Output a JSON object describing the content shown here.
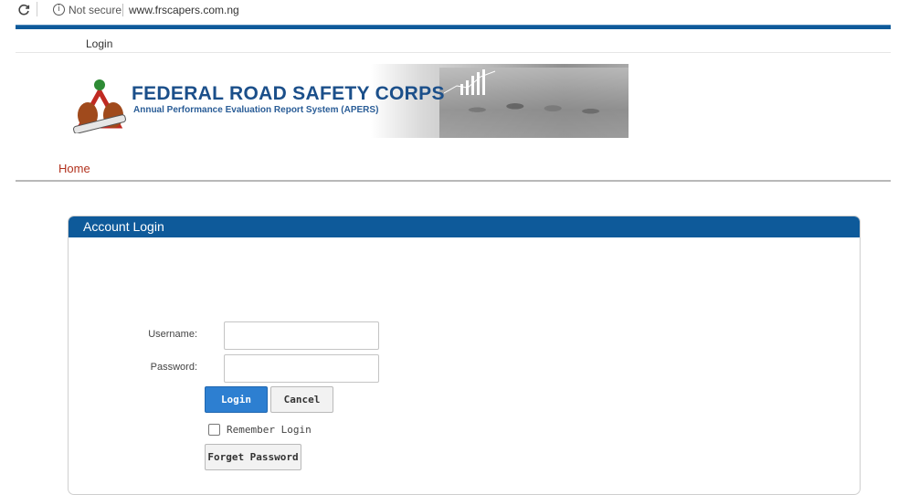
{
  "browser": {
    "not_secure": "Not secure",
    "url": "www.frscapers.com.ng"
  },
  "top": {
    "login_link": "Login"
  },
  "banner": {
    "title": "FEDERAL ROAD SAFETY CORPS",
    "subtitle": "Annual Performance Evaluation Report System (APERS)"
  },
  "nav": {
    "home": "Home"
  },
  "panel": {
    "title": "Account Login",
    "username_label": "Username:",
    "password_label": "Password:",
    "username_value": "",
    "password_value": "",
    "login_button": "Login",
    "cancel_button": "Cancel",
    "remember_label": "Remember Login",
    "remember_checked": false,
    "forget_button": "Forget Password"
  },
  "colors": {
    "brand_blue": "#0e5a9a",
    "button_blue": "#2d7fd1",
    "home_link": "#b2321e"
  }
}
